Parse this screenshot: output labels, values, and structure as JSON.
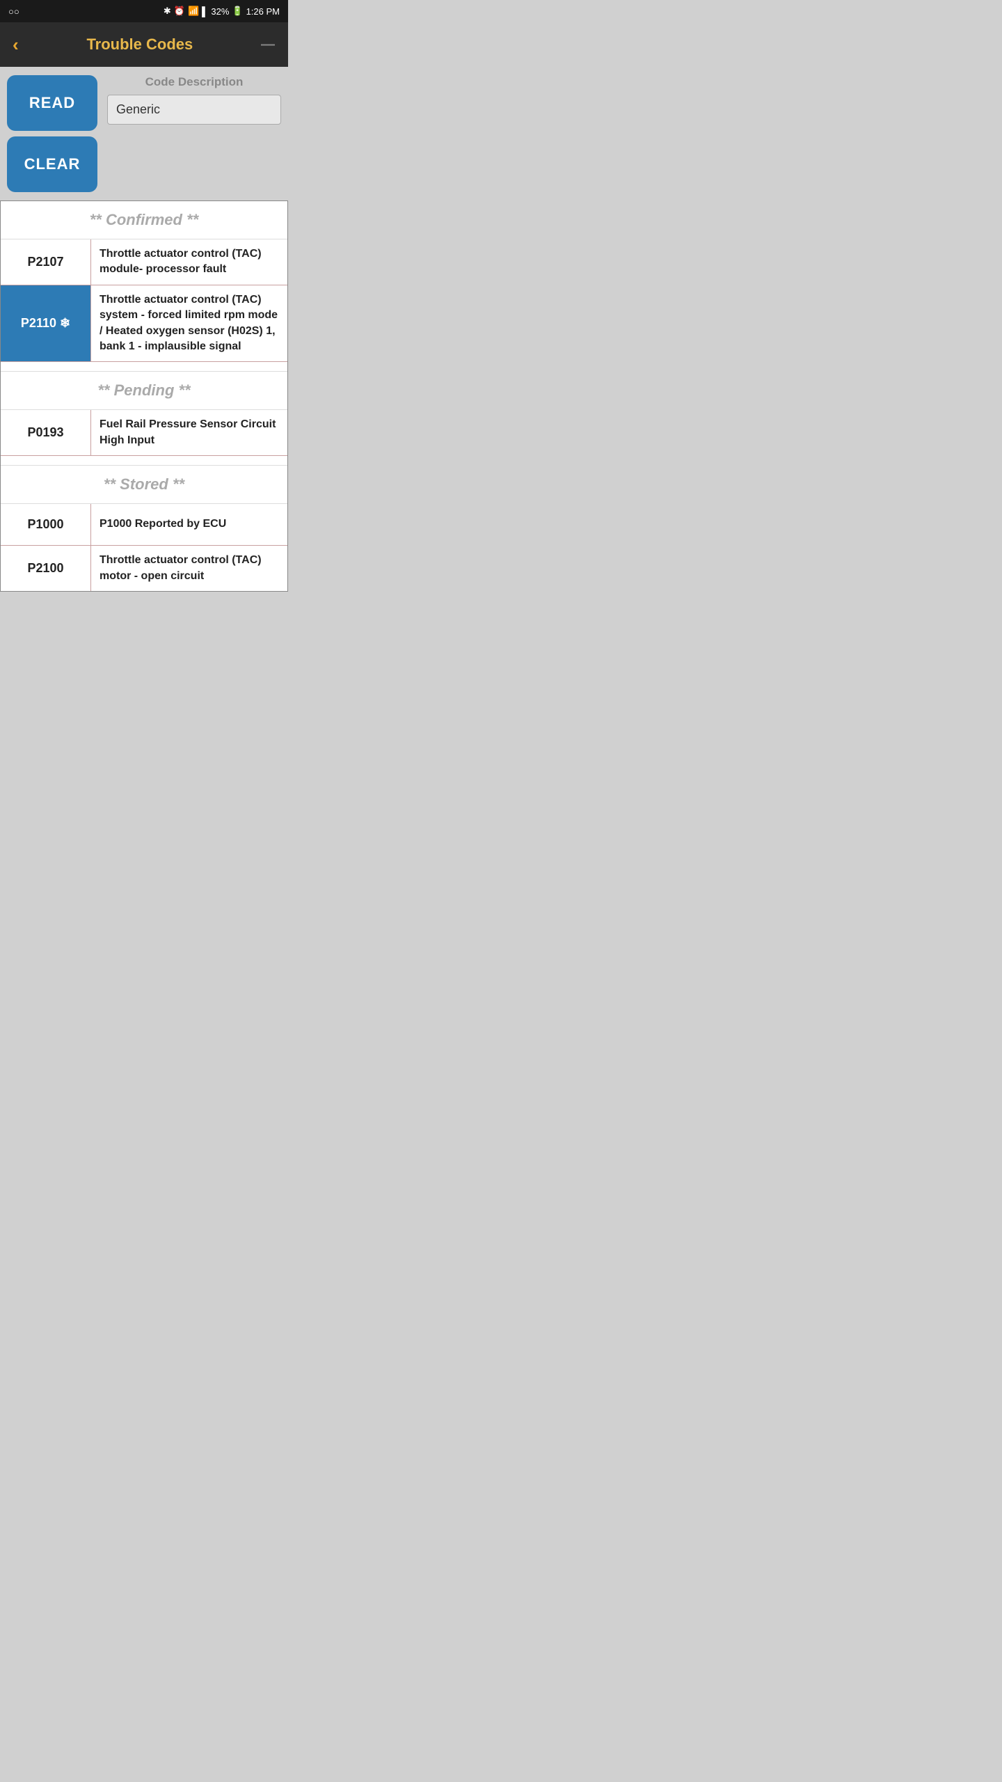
{
  "status_bar": {
    "left": "○○",
    "bluetooth": "⚙",
    "time": "1:26 PM",
    "battery": "32%",
    "signal": "▐▌"
  },
  "header": {
    "back_icon": "‹",
    "title": "Trouble Codes",
    "menu_icon": "—"
  },
  "controls": {
    "read_label": "READ",
    "clear_label": "CLEAR",
    "code_description_label": "Code Description",
    "code_description_value": "Generic"
  },
  "sections": [
    {
      "id": "confirmed",
      "header": "** Confirmed **",
      "rows": [
        {
          "code": "P2107",
          "description": "Throttle actuator control (TAC) module- processor fault",
          "highlighted": false
        },
        {
          "code": "P2110",
          "description": "Throttle actuator control (TAC) system - forced limited rpm mode / Heated oxygen sensor (H02S) 1, bank 1 - implausible signal",
          "highlighted": true
        }
      ]
    },
    {
      "id": "pending",
      "header": "** Pending **",
      "rows": [
        {
          "code": "P0193",
          "description": "Fuel Rail Pressure Sensor Circuit High Input",
          "highlighted": false
        }
      ]
    },
    {
      "id": "stored",
      "header": "** Stored **",
      "rows": [
        {
          "code": "P1000",
          "description": "P1000 Reported by ECU",
          "highlighted": false
        },
        {
          "code": "P2100",
          "description": "Throttle actuator control (TAC) motor - open circuit",
          "highlighted": false
        }
      ]
    }
  ]
}
